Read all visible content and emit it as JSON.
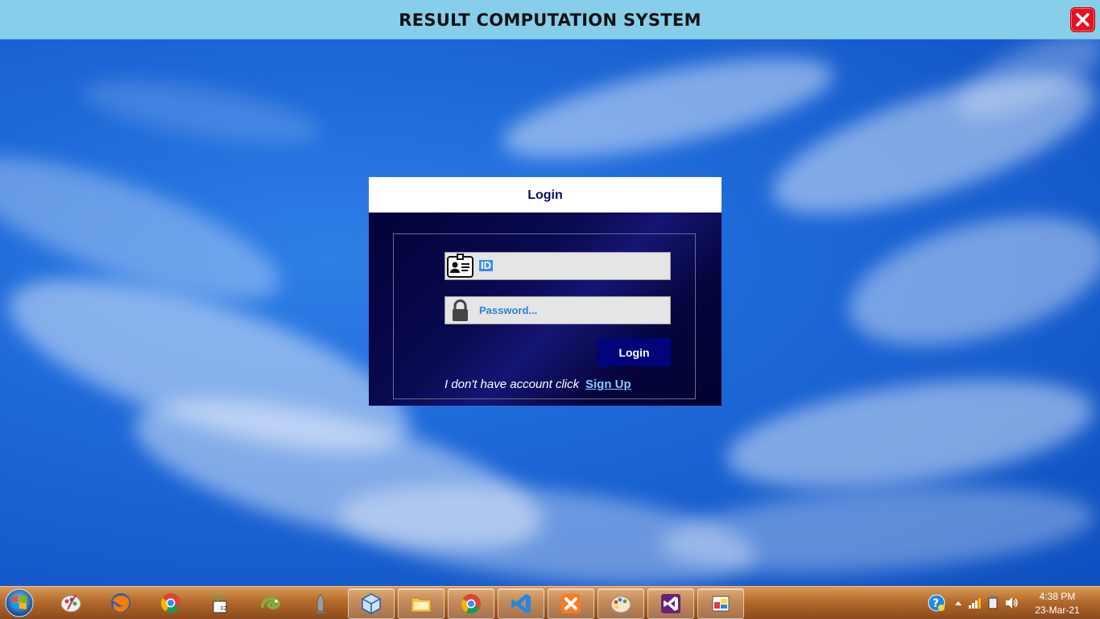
{
  "window": {
    "title": "RESULT COMPUTATION SYSTEM",
    "close_icon": "close-icon"
  },
  "login": {
    "header": "Login",
    "id_field": {
      "value": "ID",
      "icon": "id-card-icon"
    },
    "password_field": {
      "placeholder": "Password...",
      "icon": "lock-icon"
    },
    "button_label": "Login",
    "signup_text": "I don't have account click",
    "signup_link": "Sign Up",
    "colors": {
      "panel_bg": "#05054a",
      "button_bg": "#03037a",
      "link": "#88c8ff",
      "field_text": "#2f7fd6"
    }
  },
  "taskbar": {
    "apps": [
      {
        "name": "paint-brush-app",
        "icon": "palette-icon"
      },
      {
        "name": "firefox",
        "icon": "firefox-icon"
      },
      {
        "name": "chrome",
        "icon": "chrome-icon"
      },
      {
        "name": "sticker-app",
        "icon": "sprout-icon"
      },
      {
        "name": "chameleon-app",
        "icon": "chameleon-icon"
      },
      {
        "name": "rocket-app",
        "icon": "rocket-icon"
      },
      {
        "name": "virtualbox",
        "icon": "cube-icon"
      },
      {
        "name": "file-explorer",
        "icon": "folder-icon"
      },
      {
        "name": "chrome-profile",
        "icon": "chrome-icon"
      },
      {
        "name": "vscode",
        "icon": "vscode-icon"
      },
      {
        "name": "xampp",
        "icon": "xampp-icon"
      },
      {
        "name": "paint",
        "icon": "paint-icon"
      },
      {
        "name": "visual-studio",
        "icon": "visual-studio-icon"
      },
      {
        "name": "app-window",
        "icon": "window-icon"
      }
    ],
    "clock": {
      "time": "4:38 PM",
      "date": "23-Mar-21"
    }
  }
}
